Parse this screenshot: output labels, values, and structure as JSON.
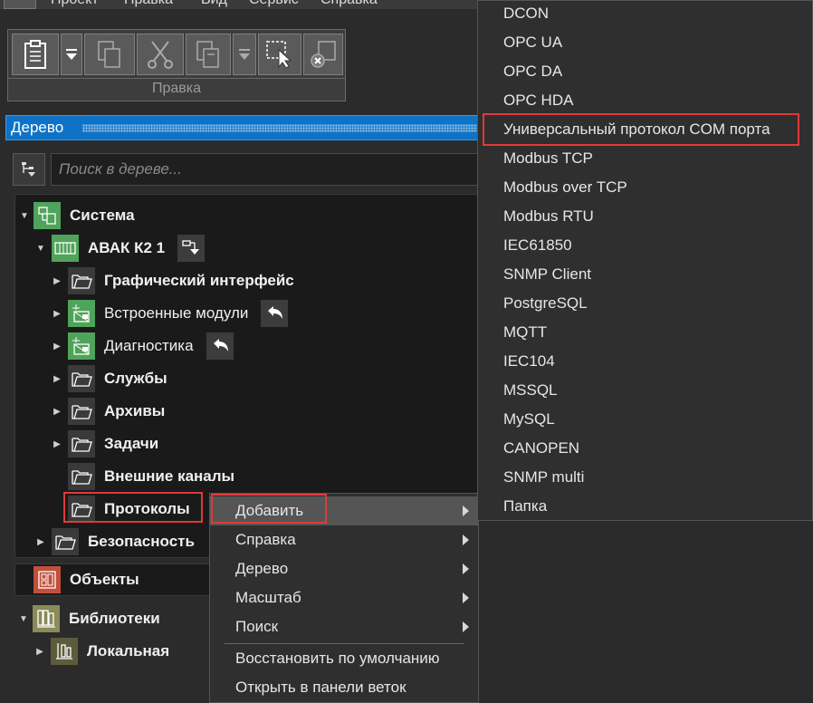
{
  "menubar": {
    "items": [
      "Проект",
      "Правка",
      "Вид",
      "Сервис",
      "Справка"
    ]
  },
  "toolbar": {
    "caption": "Правка",
    "buttons": [
      "paste-icon",
      "dropdown-icon",
      "copy-icon",
      "cut-icon",
      "duplicate-icon",
      "dropdown-icon",
      "select-icon",
      "delete-icon"
    ]
  },
  "panel": {
    "title": "Дерево"
  },
  "search": {
    "placeholder": "Поиск в дереве..."
  },
  "tree": {
    "root": "Система",
    "device": "АВАК К2 1",
    "children": [
      "Графический интерфейс",
      "Встроенные модули",
      "Диагностика",
      "Службы",
      "Архивы",
      "Задачи",
      "Внешние каналы",
      "Протоколы"
    ],
    "security": "Безопасность"
  },
  "sections": {
    "objects": "Объекты",
    "libraries": "Библиотеки",
    "local": "Локальная"
  },
  "context_menu": {
    "items": [
      {
        "label": "Добавить",
        "submenu": true
      },
      {
        "label": "Справка",
        "submenu": true
      },
      {
        "label": "Дерево",
        "submenu": true
      },
      {
        "label": "Масштаб",
        "submenu": true
      },
      {
        "label": "Поиск",
        "submenu": true
      },
      {
        "label": "Восстановить по умолчанию",
        "submenu": false
      },
      {
        "label": "Открыть в панели веток",
        "submenu": false
      }
    ]
  },
  "submenu": {
    "items": [
      "DCON",
      "OPC UA",
      "OPC DA",
      "OPC HDA",
      "Универсальный протокол COM порта",
      "Modbus TCP",
      "Modbus over TCP",
      "Modbus RTU",
      "IEC61850",
      "SNMP Client",
      "PostgreSQL",
      "MQTT",
      "IEC104",
      "MSSQL",
      "MySQL",
      "CANOPEN",
      "SNMP multi",
      "Папка"
    ]
  },
  "colors": {
    "accent": "#0e73c7",
    "highlight_border": "#e03a3a",
    "node_green": "#4fa35a",
    "node_red": "#c0503c",
    "node_olive": "#8a8a5a"
  }
}
